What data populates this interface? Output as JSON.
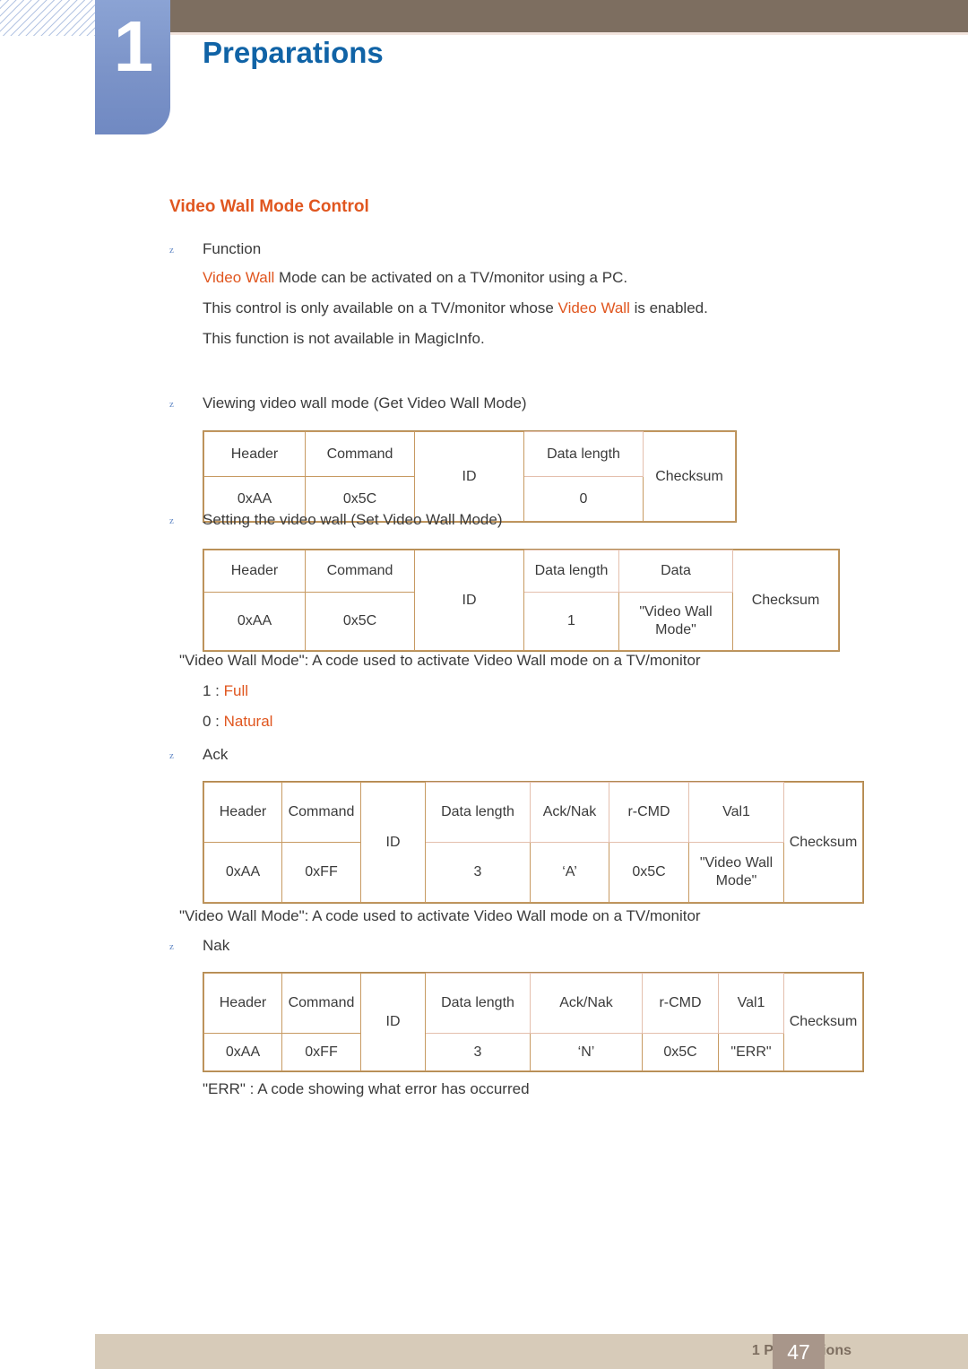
{
  "header": {
    "chapter_number": "1",
    "chapter_title": "Preparations"
  },
  "section": {
    "heading": "Video Wall Mode Control"
  },
  "bullets": {
    "function": "Function",
    "get_mode": "Viewing video wall mode (Get Video Wall Mode)",
    "set_mode": "Setting the video wall (Set Video Wall Mode)",
    "ack": "Ack",
    "nak": "Nak"
  },
  "paragraphs": {
    "func_line1_a": "Video Wall",
    "func_line1_b": " Mode can be activated on a TV/monitor using a PC.",
    "func_line2_a": "This control is only available on a TV/monitor whose ",
    "func_line2_b": "Video Wall",
    "func_line2_c": " is enabled.",
    "func_line3": "This function is not available in MagicInfo.",
    "vwm_note_1": "\"Video Wall Mode\": A code used to activate Video Wall mode on a TV/monitor",
    "val_full_num": "1 : ",
    "val_full_word": "Full",
    "val_natural_num": "0 : ",
    "val_natural_word": "Natural",
    "vwm_note_2": "\"Video Wall Mode\": A code used to activate Video Wall mode on a TV/monitor",
    "err_note": "\"ERR\" : A code showing what error has occurred"
  },
  "tables": {
    "get_video_wall_mode": {
      "headers": [
        "Header",
        "Command",
        "ID",
        "Data length",
        "Checksum"
      ],
      "values": [
        "0xAA",
        "0x5C",
        "",
        "0",
        ""
      ]
    },
    "set_video_wall_mode": {
      "headers": [
        "Header",
        "Command",
        "ID",
        "Data length",
        "Data",
        "Checksum"
      ],
      "values": [
        "0xAA",
        "0x5C",
        "",
        "1",
        "\"Video Wall Mode\"",
        ""
      ]
    },
    "ack": {
      "headers": [
        "Command",
        "ID",
        "Data length",
        "Ack/Nak",
        "r-CMD",
        "Val1",
        "Checksum"
      ],
      "header_first": "Header",
      "values": [
        "0xAA",
        "0xFF",
        "",
        "3",
        "‘A’",
        "0x5C",
        "\"Video Wall Mode\""
      ]
    },
    "nak": {
      "headers": [
        "Command",
        "ID",
        "Data length",
        "Ack/Nak",
        "r-CMD",
        "Val1",
        "Checksum"
      ],
      "header_first": "Header",
      "values": [
        "0xAA",
        "0xFF",
        "",
        "3",
        "‘N’",
        "0x5C",
        "\"ERR\""
      ]
    }
  },
  "footer": {
    "label": "1 Preparations",
    "page": "47"
  }
}
